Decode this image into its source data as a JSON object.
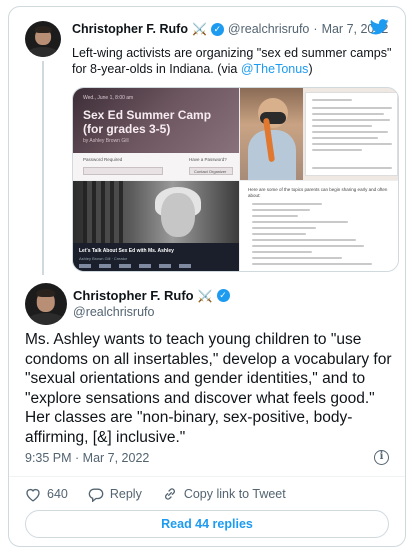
{
  "quoted_tweet": {
    "author_name": "Christopher F. Rufo",
    "name_emoji": "⚔️",
    "handle": "@realchrisrufo",
    "date": "Mar 7, 2022",
    "separator": "·",
    "text_before_link": "Left-wing activists are organizing \"sex ed summer camps\" for 8-year-olds in Indiana. (via ",
    "link_text": "@TheTonus",
    "text_after_link": ")",
    "media": {
      "camp_small_text": "Wed., June 1, 8:00 am",
      "camp_title": "Sex Ed Summer Camp (for grades 3-5)",
      "camp_by": "by Ashley Brown Gill",
      "camp_bar_left": "Password Required",
      "camp_bar_right": "Have a Password?",
      "camp_button": "Contact Organizer",
      "video_title": "Let's Talk About Sex Ed with Ms. Ashley",
      "video_subtitle": "Ashley Brown Gill · Creator",
      "list_heading": "Here are some of the topics parents can begin sharing early and often about:"
    }
  },
  "main_tweet": {
    "author_name": "Christopher F. Rufo",
    "name_emoji": "⚔️",
    "handle": "@realchrisrufo",
    "text": "Ms. Ashley wants to teach young children to \"use condoms on all insertables,\" develop a vocabulary for \"sexual orientations and gender identities,\" and to \"explore sensations and discover what feels good.\" Her classes are \"non-binary, sex-positive, body-affirming, [&] inclusive.\"",
    "time": "9:35 PM",
    "date": "Mar 7, 2022",
    "separator": "·",
    "time_date": "9:35 PM · Mar 7, 2022",
    "likes": "640",
    "reply_label": "Reply",
    "copy_link_label": "Copy link to Tweet",
    "read_replies_label": "Read 44 replies"
  },
  "icons": {
    "verified": "verified-badge-icon",
    "twitter": "twitter-bird-icon",
    "info": "info-icon",
    "like": "heart-icon",
    "reply": "reply-bubble-icon",
    "copy_link": "link-icon"
  },
  "colors": {
    "accent": "#1d9bf0",
    "text": "#0f1419",
    "muted": "#536471",
    "border": "#cfd9de"
  }
}
